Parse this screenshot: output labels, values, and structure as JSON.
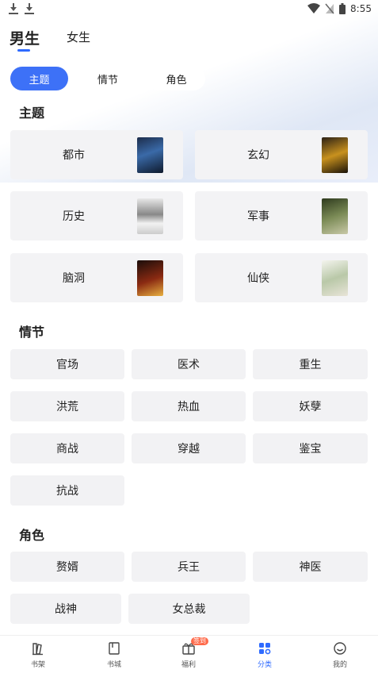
{
  "status_bar": {
    "time": "8:55"
  },
  "gender_tabs": [
    {
      "label": "男生",
      "active": true
    },
    {
      "label": "女生",
      "active": false
    }
  ],
  "filter_pills": [
    {
      "label": "主题",
      "active": true
    },
    {
      "label": "情节",
      "active": false
    },
    {
      "label": "角色",
      "active": false
    }
  ],
  "sections": {
    "theme": {
      "title": "主题",
      "items": [
        {
          "label": "都市",
          "cover": "cover-urban-icon"
        },
        {
          "label": "玄幻",
          "cover": "cover-fantasy-icon"
        },
        {
          "label": "历史",
          "cover": "cover-history-icon"
        },
        {
          "label": "军事",
          "cover": "cover-military-icon"
        },
        {
          "label": "脑洞",
          "cover": "cover-brainstorm-icon"
        },
        {
          "label": "仙侠",
          "cover": "cover-xianxia-icon"
        }
      ]
    },
    "plot": {
      "title": "情节",
      "items": [
        "官场",
        "医术",
        "重生",
        "洪荒",
        "热血",
        "妖孽",
        "商战",
        "穿越",
        "鉴宝",
        "抗战"
      ]
    },
    "role": {
      "title": "角色",
      "items": [
        "赘婿",
        "兵王",
        "神医",
        "战神",
        "女总裁"
      ]
    }
  },
  "bottom_nav": [
    {
      "label": "书架",
      "icon": "bookshelf-icon",
      "active": false
    },
    {
      "label": "书城",
      "icon": "bookstore-icon",
      "active": false
    },
    {
      "label": "福利",
      "icon": "gift-icon",
      "active": false,
      "badge": "签到"
    },
    {
      "label": "分类",
      "icon": "category-icon",
      "active": true
    },
    {
      "label": "我的",
      "icon": "profile-icon",
      "active": false
    }
  ],
  "colors": {
    "accent": "#3d71f7",
    "badge": "#ff6a4a",
    "card_bg": "#f3f3f5"
  }
}
